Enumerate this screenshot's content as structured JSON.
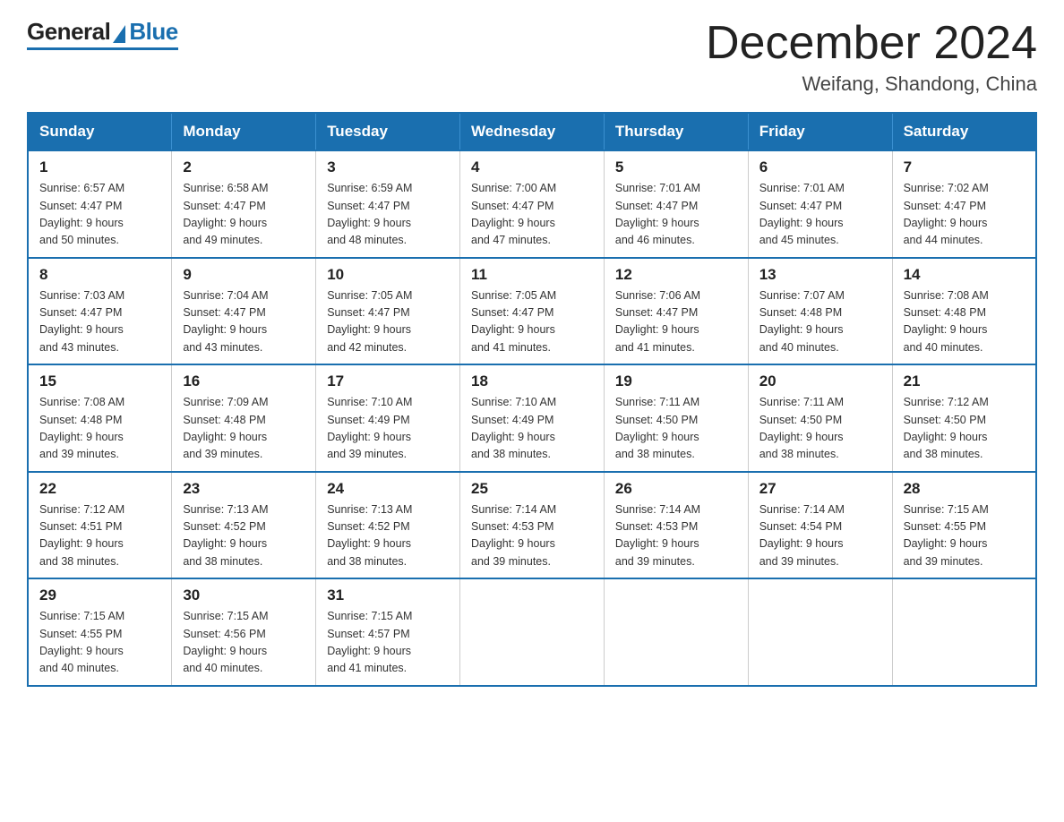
{
  "header": {
    "logo": {
      "general": "General",
      "blue": "Blue"
    },
    "title": "December 2024",
    "location": "Weifang, Shandong, China"
  },
  "weekdays": [
    "Sunday",
    "Monday",
    "Tuesday",
    "Wednesday",
    "Thursday",
    "Friday",
    "Saturday"
  ],
  "weeks": [
    [
      {
        "day": "1",
        "sunrise": "6:57 AM",
        "sunset": "4:47 PM",
        "daylight": "9 hours and 50 minutes."
      },
      {
        "day": "2",
        "sunrise": "6:58 AM",
        "sunset": "4:47 PM",
        "daylight": "9 hours and 49 minutes."
      },
      {
        "day": "3",
        "sunrise": "6:59 AM",
        "sunset": "4:47 PM",
        "daylight": "9 hours and 48 minutes."
      },
      {
        "day": "4",
        "sunrise": "7:00 AM",
        "sunset": "4:47 PM",
        "daylight": "9 hours and 47 minutes."
      },
      {
        "day": "5",
        "sunrise": "7:01 AM",
        "sunset": "4:47 PM",
        "daylight": "9 hours and 46 minutes."
      },
      {
        "day": "6",
        "sunrise": "7:01 AM",
        "sunset": "4:47 PM",
        "daylight": "9 hours and 45 minutes."
      },
      {
        "day": "7",
        "sunrise": "7:02 AM",
        "sunset": "4:47 PM",
        "daylight": "9 hours and 44 minutes."
      }
    ],
    [
      {
        "day": "8",
        "sunrise": "7:03 AM",
        "sunset": "4:47 PM",
        "daylight": "9 hours and 43 minutes."
      },
      {
        "day": "9",
        "sunrise": "7:04 AM",
        "sunset": "4:47 PM",
        "daylight": "9 hours and 43 minutes."
      },
      {
        "day": "10",
        "sunrise": "7:05 AM",
        "sunset": "4:47 PM",
        "daylight": "9 hours and 42 minutes."
      },
      {
        "day": "11",
        "sunrise": "7:05 AM",
        "sunset": "4:47 PM",
        "daylight": "9 hours and 41 minutes."
      },
      {
        "day": "12",
        "sunrise": "7:06 AM",
        "sunset": "4:47 PM",
        "daylight": "9 hours and 41 minutes."
      },
      {
        "day": "13",
        "sunrise": "7:07 AM",
        "sunset": "4:48 PM",
        "daylight": "9 hours and 40 minutes."
      },
      {
        "day": "14",
        "sunrise": "7:08 AM",
        "sunset": "4:48 PM",
        "daylight": "9 hours and 40 minutes."
      }
    ],
    [
      {
        "day": "15",
        "sunrise": "7:08 AM",
        "sunset": "4:48 PM",
        "daylight": "9 hours and 39 minutes."
      },
      {
        "day": "16",
        "sunrise": "7:09 AM",
        "sunset": "4:48 PM",
        "daylight": "9 hours and 39 minutes."
      },
      {
        "day": "17",
        "sunrise": "7:10 AM",
        "sunset": "4:49 PM",
        "daylight": "9 hours and 39 minutes."
      },
      {
        "day": "18",
        "sunrise": "7:10 AM",
        "sunset": "4:49 PM",
        "daylight": "9 hours and 38 minutes."
      },
      {
        "day": "19",
        "sunrise": "7:11 AM",
        "sunset": "4:50 PM",
        "daylight": "9 hours and 38 minutes."
      },
      {
        "day": "20",
        "sunrise": "7:11 AM",
        "sunset": "4:50 PM",
        "daylight": "9 hours and 38 minutes."
      },
      {
        "day": "21",
        "sunrise": "7:12 AM",
        "sunset": "4:50 PM",
        "daylight": "9 hours and 38 minutes."
      }
    ],
    [
      {
        "day": "22",
        "sunrise": "7:12 AM",
        "sunset": "4:51 PM",
        "daylight": "9 hours and 38 minutes."
      },
      {
        "day": "23",
        "sunrise": "7:13 AM",
        "sunset": "4:52 PM",
        "daylight": "9 hours and 38 minutes."
      },
      {
        "day": "24",
        "sunrise": "7:13 AM",
        "sunset": "4:52 PM",
        "daylight": "9 hours and 38 minutes."
      },
      {
        "day": "25",
        "sunrise": "7:14 AM",
        "sunset": "4:53 PM",
        "daylight": "9 hours and 39 minutes."
      },
      {
        "day": "26",
        "sunrise": "7:14 AM",
        "sunset": "4:53 PM",
        "daylight": "9 hours and 39 minutes."
      },
      {
        "day": "27",
        "sunrise": "7:14 AM",
        "sunset": "4:54 PM",
        "daylight": "9 hours and 39 minutes."
      },
      {
        "day": "28",
        "sunrise": "7:15 AM",
        "sunset": "4:55 PM",
        "daylight": "9 hours and 39 minutes."
      }
    ],
    [
      {
        "day": "29",
        "sunrise": "7:15 AM",
        "sunset": "4:55 PM",
        "daylight": "9 hours and 40 minutes."
      },
      {
        "day": "30",
        "sunrise": "7:15 AM",
        "sunset": "4:56 PM",
        "daylight": "9 hours and 40 minutes."
      },
      {
        "day": "31",
        "sunrise": "7:15 AM",
        "sunset": "4:57 PM",
        "daylight": "9 hours and 41 minutes."
      },
      null,
      null,
      null,
      null
    ]
  ],
  "labels": {
    "sunrise_prefix": "Sunrise: ",
    "sunset_prefix": "Sunset: ",
    "daylight_prefix": "Daylight: "
  }
}
